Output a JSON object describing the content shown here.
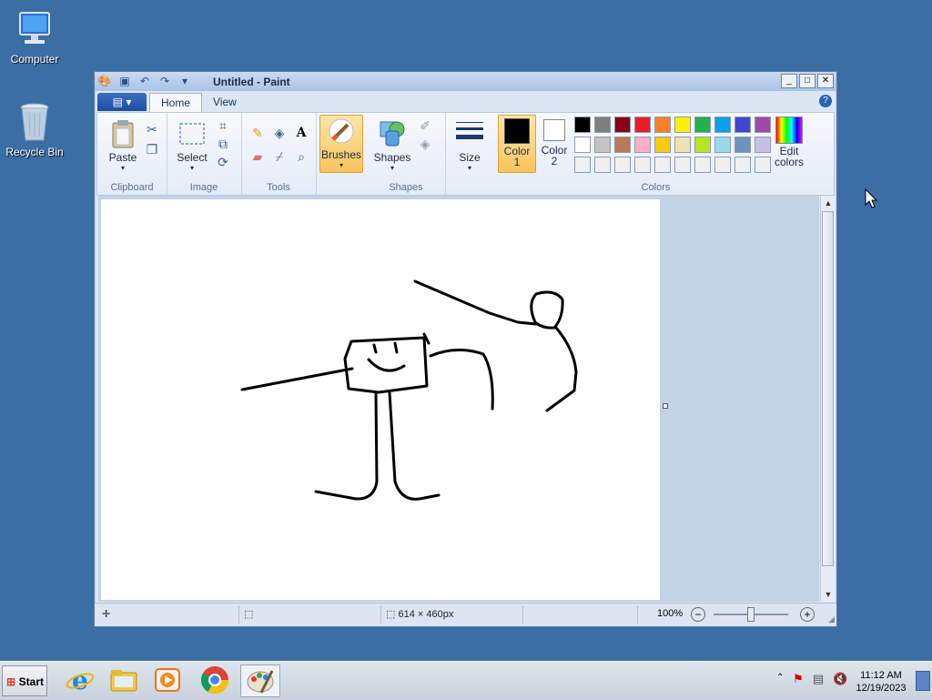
{
  "desktop": {
    "icons": [
      {
        "label": "Computer"
      },
      {
        "label": "Recycle Bin"
      }
    ]
  },
  "window": {
    "title": "Untitled - Paint",
    "tabs": [
      {
        "label": "Home"
      },
      {
        "label": "View"
      }
    ]
  },
  "ribbon": {
    "clipboard": {
      "paste": "Paste",
      "group": "Clipboard"
    },
    "image": {
      "select": "Select",
      "group": "Image"
    },
    "tools": {
      "group": "Tools",
      "text_glyph": "A"
    },
    "brushes": {
      "label": "Brushes"
    },
    "shapes": {
      "label": "Shapes",
      "group": "Shapes"
    },
    "size": {
      "label": "Size"
    },
    "color1": {
      "line1": "Color",
      "line2": "1",
      "value": "#000000"
    },
    "color2": {
      "line1": "Color",
      "line2": "2",
      "value": "#ffffff"
    },
    "colors_group": "Colors",
    "edit_colors": {
      "line1": "Edit",
      "line2": "colors"
    },
    "palette_row1": [
      "#000000",
      "#7f7f7f",
      "#880015",
      "#ed1c24",
      "#ff7f27",
      "#fff200",
      "#22b14c",
      "#00a2e8",
      "#3f48cc",
      "#a349a4"
    ],
    "palette_row2": [
      "#ffffff",
      "#c3c3c3",
      "#b97a57",
      "#ffaec9",
      "#ffc90e",
      "#efe4b0",
      "#b5e61d",
      "#99d9ea",
      "#7092be",
      "#c8bfe7"
    ],
    "palette_row3": [
      "#f0f0f0",
      "#f0f0f0",
      "#f0f0f0",
      "#f0f0f0",
      "#f0f0f0",
      "#f0f0f0",
      "#f0f0f0",
      "#f0f0f0",
      "#f0f0f0",
      "#f0f0f0"
    ]
  },
  "status": {
    "dimensions": "614 × 460px",
    "zoom": "100%",
    "zoom_level": 1.0
  },
  "taskbar": {
    "start": "Start",
    "time": "11:12 AM",
    "date": "12/19/2023"
  }
}
